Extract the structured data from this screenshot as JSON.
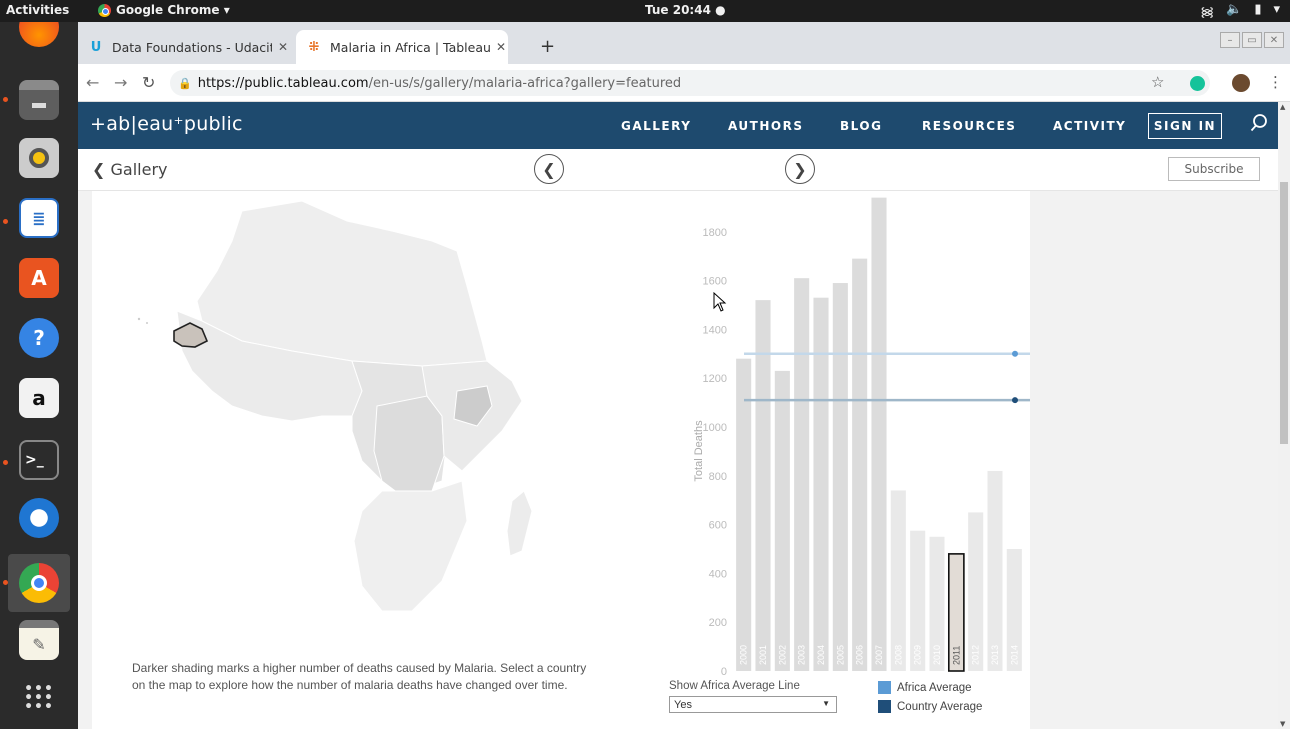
{
  "system": {
    "activities": "Activities",
    "app_menu": "Google Chrome ▾",
    "clock": "Tue 20:44 ●"
  },
  "browser": {
    "tabs": [
      {
        "title": "Data Foundations - Udacity",
        "favicon": "udacity-icon"
      },
      {
        "title": "Malaria in Africa | Tableau Public",
        "favicon": "tableau-icon",
        "active": true
      }
    ],
    "url_host": "https://public.tableau.com",
    "url_path": "/en-us/s/gallery/malaria-africa?gallery=featured"
  },
  "tableau": {
    "logo": "+ab|eau⁺public",
    "nav": [
      "GALLERY",
      "AUTHORS",
      "BLOG",
      "RESOURCES",
      "ACTIVITY"
    ],
    "sign_in": "SIGN IN",
    "back_label": "Gallery",
    "subscribe": "Subscribe"
  },
  "viz": {
    "caption": "Darker shading marks a higher number of deaths caused by Malaria. Select a country on the map to explore how the number of malaria deaths have changed over time.",
    "control_label": "Show Africa Average Line",
    "control_value": "Yes",
    "legend": [
      {
        "label": "Africa Average",
        "color": "#5b9bd5"
      },
      {
        "label": "Country Average",
        "color": "#1f4e79"
      }
    ]
  },
  "chart_data": {
    "type": "bar",
    "ylabel": "Total Deaths",
    "ylim": [
      0,
      2000
    ],
    "yticks": [
      0,
      200,
      400,
      600,
      800,
      1000,
      1200,
      1400,
      1600,
      1800,
      2000
    ],
    "categories": [
      "2000",
      "2001",
      "2002",
      "2003",
      "2004",
      "2005",
      "2006",
      "2007",
      "2008",
      "2009",
      "2010",
      "2011",
      "2012",
      "2013",
      "2014"
    ],
    "values": [
      1280,
      1520,
      1230,
      1610,
      1530,
      1590,
      1690,
      1940,
      740,
      575,
      550,
      480,
      650,
      820,
      500
    ],
    "selected": "2011",
    "reference_lines": [
      {
        "name": "Africa Average",
        "value": 1300,
        "color": "#5b9bd5"
      },
      {
        "name": "Country Average",
        "value": 1110,
        "color": "#1f4e79"
      }
    ]
  }
}
